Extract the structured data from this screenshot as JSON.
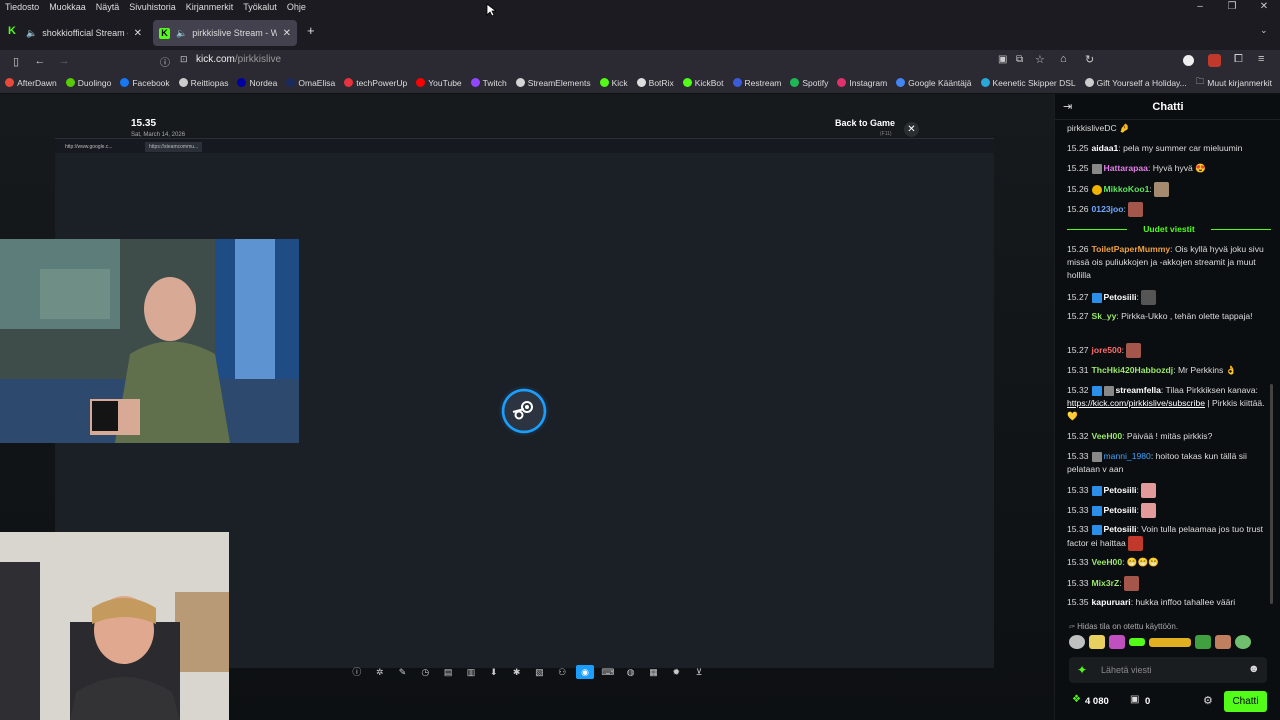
{
  "menubar": {
    "items": [
      "Tiedosto",
      "Muokkaa",
      "Näytä",
      "Sivuhistoria",
      "Kirjanmerkit",
      "Työkalut",
      "Ohje"
    ],
    "window_controls": [
      "–",
      "❐",
      "✕"
    ]
  },
  "tabs": [
    {
      "title": "shokkiofficial Stream - Watc",
      "active": false
    },
    {
      "title": "pirkkislive Stream - Watch L",
      "active": true
    }
  ],
  "new_tab": "+",
  "url": {
    "host": "kick.com",
    "path": "/pirkkislive"
  },
  "bookmarks": [
    {
      "label": "AfterDawn",
      "color": "#e84a3a"
    },
    {
      "label": "Duolingo",
      "color": "#58cc02"
    },
    {
      "label": "Facebook",
      "color": "#1877f2"
    },
    {
      "label": "Reittiopas",
      "color": "#cccccc"
    },
    {
      "label": "Nordea",
      "color": "#0000a0"
    },
    {
      "label": "OmaElisa",
      "color": "#1b2a5c"
    },
    {
      "label": "techPowerUp",
      "color": "#e8323c"
    },
    {
      "label": "YouTube",
      "color": "#ff0000"
    },
    {
      "label": "Twitch",
      "color": "#9146ff"
    },
    {
      "label": "StreamElements",
      "color": "#d4d4d4"
    },
    {
      "label": "Kick",
      "color": "#53fc18"
    },
    {
      "label": "BotRix",
      "color": "#dddddd"
    },
    {
      "label": "KickBot",
      "color": "#53fc18"
    },
    {
      "label": "Restream",
      "color": "#3b5bdb"
    },
    {
      "label": "Spotify",
      "color": "#1db954"
    },
    {
      "label": "Instagram",
      "color": "#e1306c"
    },
    {
      "label": "Google Kääntäjä",
      "color": "#4285f4"
    },
    {
      "label": "Keenetic Skipper DSL",
      "color": "#2aa7d7"
    },
    {
      "label": "Gift Yourself a Holiday...",
      "color": "#cccccc"
    }
  ],
  "other_bookmarks": "Muut kirjanmerkit",
  "stream": {
    "clock": "15.35",
    "date": "Sat, March 14, 2026",
    "back_to_game": "Back to Game",
    "back_to_game_hint": "(F11)",
    "browser_tabs": [
      "http://www.google.c...",
      "https://steamcommu..."
    ]
  },
  "chat": {
    "title": "Chatti",
    "new_messages_label": "Uudet viestit",
    "messages": [
      {
        "time": "",
        "user": "pirkkisliveDC",
        "color": "#dddddd",
        "text": ""
      },
      {
        "time": "15.25",
        "user": "aidaa1",
        "color": "#ffffff",
        "text": "pela my summer car mieluumin"
      },
      {
        "time": "15.25",
        "user": "Hattarapaa",
        "color": "#e37de8",
        "text": "Hyvä hyvä"
      },
      {
        "time": "15.26",
        "user": "MikkoKoo1",
        "color": "#5ce35c",
        "text": ""
      },
      {
        "time": "15.26",
        "user": "0123joo",
        "color": "#6fa8ff",
        "text": ""
      },
      {
        "time": "15.26",
        "user": "ToiletPaperMummy",
        "color": "#f0a040",
        "text": "Ois kyllä hyvä joku sivu missä ois puliukkojen ja -akkojen streamit ja muut hollilla"
      },
      {
        "time": "15.27",
        "user": "Petosiili",
        "color": "#ffffff",
        "text": ""
      },
      {
        "time": "15.27",
        "user": "Sk_yy",
        "color": "#9be86a",
        "text": "Pirkka-Ukko , tehän olette tappaja!"
      },
      {
        "time": "15.27",
        "user": "jore500",
        "color": "#ff6b6b",
        "text": ""
      },
      {
        "time": "15.31",
        "user": "ThcHki420Habbozdj",
        "color": "#9be86a",
        "text": "Mr Perkkins"
      },
      {
        "time": "15.32",
        "user": "streamfella",
        "color": "#ffffff",
        "text": "Tilaa Pirkkiksen kanava: "
      },
      {
        "time": "15.32",
        "user": "VeeH00",
        "color": "#9be86a",
        "text": "Päivää ! mitäs pirkkis?"
      },
      {
        "time": "15.33",
        "user": "manni_1980",
        "color": "#3fa0ff",
        "text": "hoitoo takas kun tällä sii pelataan v aan"
      },
      {
        "time": "15.33",
        "user": "Petosiili",
        "color": "#ffffff",
        "text": ""
      },
      {
        "time": "15.33",
        "user": "Petosiili",
        "color": "#ffffff",
        "text": ""
      },
      {
        "time": "15.33",
        "user": "Petosiili",
        "color": "#ffffff",
        "text": "Voin tulla pelaamaa jos tuo trust factor ei haittaa"
      },
      {
        "time": "15.33",
        "user": "VeeH00",
        "color": "#9be86a",
        "text": ""
      },
      {
        "time": "15.33",
        "user": "Mix3rZ",
        "color": "#9be86a",
        "text": ""
      },
      {
        "time": "15.35",
        "user": "kapuruari",
        "color": "#ffffff",
        "text": "hukka inffoo tahallee vääri"
      }
    ],
    "streamfella_link": "https://kick.com/pirkkislive/subscribe",
    "streamfella_tail": "| Pirkkis kiittää.",
    "slow_mode": "Hidas tila on otettu käyttöön.",
    "input_placeholder": "Lähetä viesti",
    "points": "4 080",
    "gifts": "0",
    "send_label": "Chatti"
  }
}
